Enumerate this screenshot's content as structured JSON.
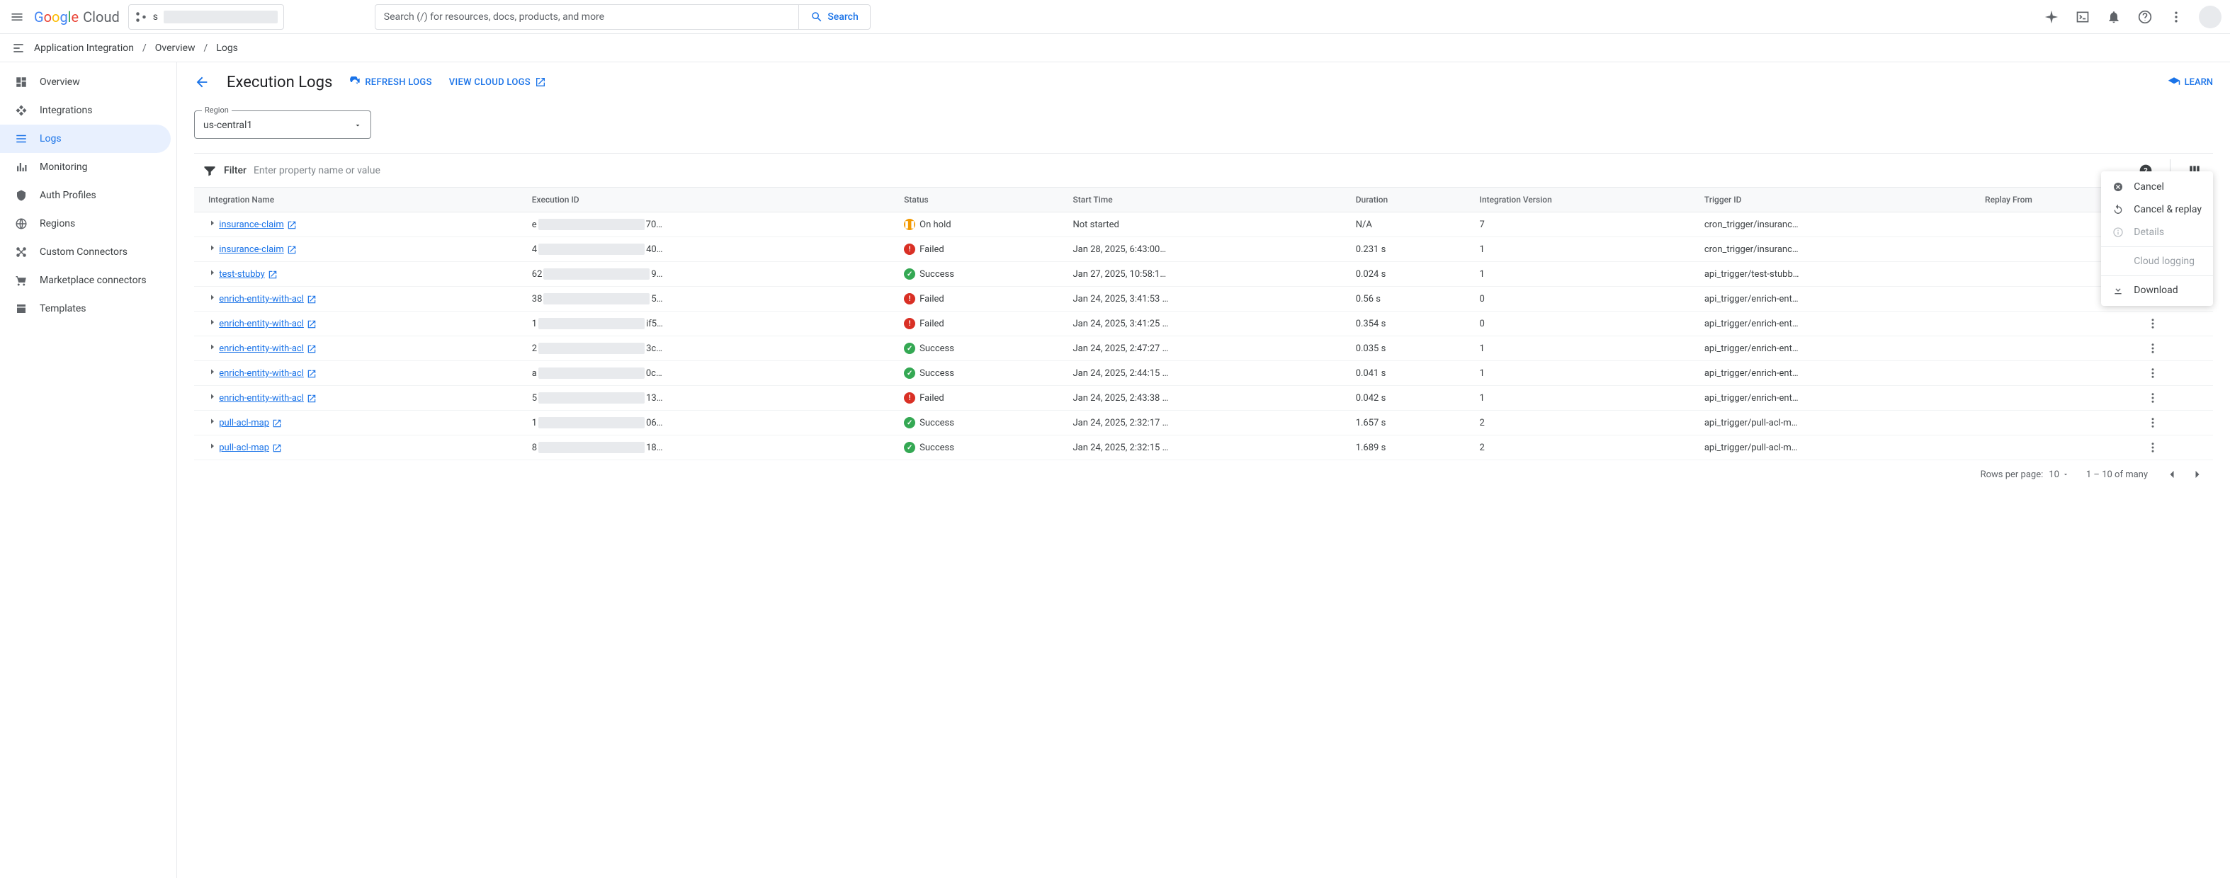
{
  "header": {
    "logo_google": "Google",
    "logo_cloud": "Cloud",
    "project_prefix": "s",
    "search_placeholder": "Search (/) for resources, docs, products, and more",
    "search_button": "Search"
  },
  "breadcrumb": {
    "product": "Application Integration",
    "parts": [
      "Overview",
      "Logs"
    ]
  },
  "sidebar": {
    "items": [
      {
        "label": "Overview"
      },
      {
        "label": "Integrations"
      },
      {
        "label": "Logs"
      },
      {
        "label": "Monitoring"
      },
      {
        "label": "Auth Profiles"
      },
      {
        "label": "Regions"
      },
      {
        "label": "Custom Connectors"
      },
      {
        "label": "Marketplace connectors"
      },
      {
        "label": "Templates"
      }
    ]
  },
  "page": {
    "title": "Execution Logs",
    "refresh": "Refresh Logs",
    "view_cloud": "View Cloud Logs",
    "learn": "LEARN",
    "region_label": "Region",
    "region_value": "us-central1"
  },
  "filter": {
    "label": "Filter",
    "placeholder": "Enter property name or value"
  },
  "table": {
    "columns": [
      "Integration Name",
      "Execution ID",
      "Status",
      "Start Time",
      "Duration",
      "Integration Version",
      "Trigger ID",
      "Replay From",
      ""
    ],
    "rows": [
      {
        "name": "insurance-claim",
        "exec_prefix": "e",
        "exec_suffix": "70…",
        "status": "On hold",
        "status_type": "hold",
        "start": "Not started",
        "duration": "N/A",
        "version": "7",
        "trigger": "cron_trigger/insuranc…",
        "replay": ""
      },
      {
        "name": "insurance-claim",
        "exec_prefix": "4",
        "exec_suffix": "40…",
        "status": "Failed",
        "status_type": "failed",
        "start": "Jan 28, 2025, 6:43:00…",
        "duration": "0.231 s",
        "version": "1",
        "trigger": "cron_trigger/insuranc…",
        "replay": ""
      },
      {
        "name": "test-stubby",
        "exec_prefix": "62",
        "exec_suffix": "9…",
        "status": "Success",
        "status_type": "success",
        "start": "Jan 27, 2025, 10:58:1…",
        "duration": "0.024 s",
        "version": "1",
        "trigger": "api_trigger/test-stubb…",
        "replay": ""
      },
      {
        "name": "enrich-entity-with-acl",
        "exec_prefix": "38",
        "exec_suffix": "5…",
        "status": "Failed",
        "status_type": "failed",
        "start": "Jan 24, 2025, 3:41:53 …",
        "duration": "0.56 s",
        "version": "0",
        "trigger": "api_trigger/enrich-ent…",
        "replay": ""
      },
      {
        "name": "enrich-entity-with-acl",
        "exec_prefix": "1",
        "exec_suffix": "if5…",
        "status": "Failed",
        "status_type": "failed",
        "start": "Jan 24, 2025, 3:41:25 …",
        "duration": "0.354 s",
        "version": "0",
        "trigger": "api_trigger/enrich-ent…",
        "replay": ""
      },
      {
        "name": "enrich-entity-with-acl",
        "exec_prefix": "2",
        "exec_suffix": "3c…",
        "status": "Success",
        "status_type": "success",
        "start": "Jan 24, 2025, 2:47:27 …",
        "duration": "0.035 s",
        "version": "1",
        "trigger": "api_trigger/enrich-ent…",
        "replay": ""
      },
      {
        "name": "enrich-entity-with-acl",
        "exec_prefix": "a",
        "exec_suffix": "0c…",
        "status": "Success",
        "status_type": "success",
        "start": "Jan 24, 2025, 2:44:15 …",
        "duration": "0.041 s",
        "version": "1",
        "trigger": "api_trigger/enrich-ent…",
        "replay": ""
      },
      {
        "name": "enrich-entity-with-acl",
        "exec_prefix": "5",
        "exec_suffix": "13…",
        "status": "Failed",
        "status_type": "failed",
        "start": "Jan 24, 2025, 2:43:38 …",
        "duration": "0.042 s",
        "version": "1",
        "trigger": "api_trigger/enrich-ent…",
        "replay": ""
      },
      {
        "name": "pull-acl-map",
        "exec_prefix": "1",
        "exec_suffix": "06…",
        "status": "Success",
        "status_type": "success",
        "start": "Jan 24, 2025, 2:32:17 …",
        "duration": "1.657 s",
        "version": "2",
        "trigger": "api_trigger/pull-acl-m…",
        "replay": ""
      },
      {
        "name": "pull-acl-map",
        "exec_prefix": "8",
        "exec_suffix": "18…",
        "status": "Success",
        "status_type": "success",
        "start": "Jan 24, 2025, 2:32:15 …",
        "duration": "1.689 s",
        "version": "2",
        "trigger": "api_trigger/pull-acl-m…",
        "replay": ""
      }
    ]
  },
  "context_menu": {
    "cancel": "Cancel",
    "cancel_replay": "Cancel & replay",
    "details": "Details",
    "cloud_logging": "Cloud logging",
    "download": "Download"
  },
  "pagination": {
    "rows_label": "Rows per page:",
    "rows_value": "10",
    "range": "1 – 10 of many"
  }
}
